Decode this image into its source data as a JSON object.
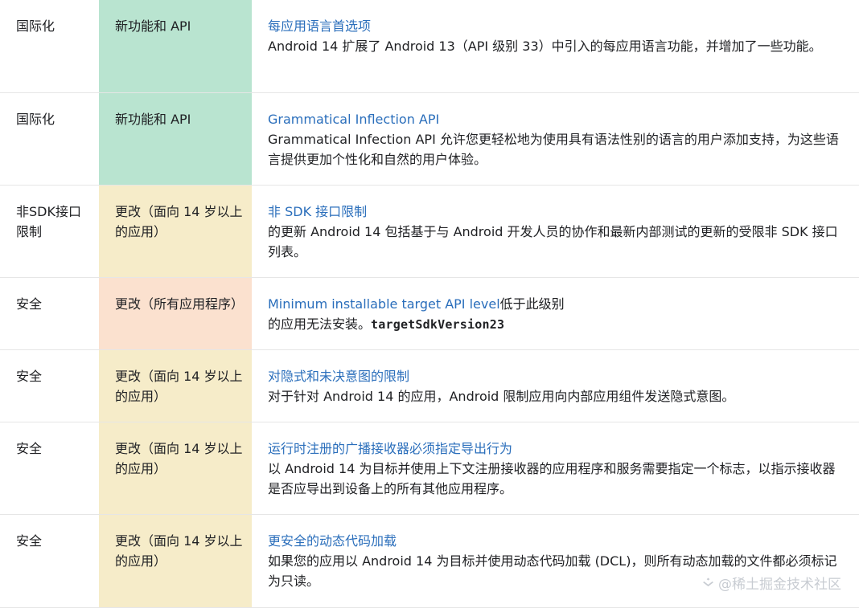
{
  "rows": [
    {
      "area": "国际化",
      "type": "新功能和 API",
      "type_kind": "feature",
      "link_text": "每应用语言首选项",
      "desc": "Android 14 扩展了 Android 13（API 级别 33）中引入的每应用语言功能，并增加了一些功能。"
    },
    {
      "area": "国际化",
      "type": "新功能和 API",
      "type_kind": "feature",
      "link_text": "Grammatical Inflection API",
      "desc": "Grammatical Infection API 允许您更轻松地为使用具有语法性别的语言的用户添加支持，为这些语言提供更加个性化和自然的用户体验。"
    },
    {
      "area": "非SDK接口限制",
      "type": "更改（面向 14 岁以上的应用）",
      "type_kind": "change14",
      "link_text": "非 SDK 接口限制",
      "desc": "的更新 Android 14 包括基于与 Android 开发人员的协作和最新内部测试的更新的受限非 SDK 接口列表。"
    },
    {
      "area": "安全",
      "type": "更改（所有应用程序）",
      "type_kind": "changeall",
      "link_text": "Minimum installable target API level",
      "link_suffix": "低于此级别",
      "desc": "的应用无法安装。",
      "code": "targetSdkVersion23"
    },
    {
      "area": "安全",
      "type": "更改（面向 14 岁以上的应用）",
      "type_kind": "change14",
      "link_text": "对隐式和未决意图的限制",
      "desc": "对于针对 Android 14 的应用，Android 限制应用向内部应用组件发送隐式意图。"
    },
    {
      "area": "安全",
      "type": "更改（面向 14 岁以上的应用）",
      "type_kind": "change14",
      "link_text": "运行时注册的广播接收器必须指定导出行为",
      "desc": "以 Android 14 为目标并使用上下文注册接收器的应用程序和服务需要指定一个标志，以指示接收器是否应导出到设备上的所有其他应用程序。"
    },
    {
      "area": "安全",
      "type": "更改（面向 14 岁以上的应用）",
      "type_kind": "change14",
      "link_text": "更安全的动态代码加载",
      "desc": "如果您的应用以 Android 14 为目标并使用动态代码加载 (DCL)，则所有动态加载的文件都必须标记为只读。"
    }
  ],
  "watermark": {
    "text": "@稀土掘金技术社区",
    "icon": "juejin-logo-icon"
  },
  "colors": {
    "feature": "#b9e4d0",
    "change14": "#f6ecc9",
    "changeall": "#fbe1cf",
    "link": "#2a6ebb"
  }
}
